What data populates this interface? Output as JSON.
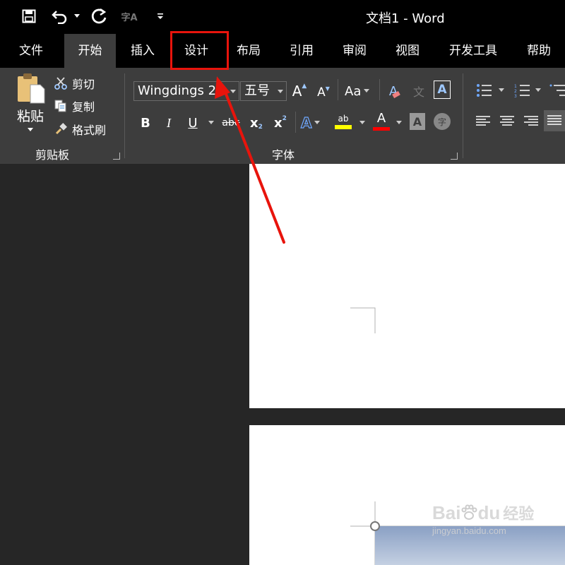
{
  "titlebar": {
    "title": "文档1  -  Word",
    "qat_icons": [
      "save-icon",
      "undo-icon",
      "redo-icon",
      "spelling-icon",
      "customize-qat-icon"
    ],
    "spelling_label": "字A"
  },
  "tabs": [
    {
      "label": "文件",
      "active": false
    },
    {
      "label": "开始",
      "active": true
    },
    {
      "label": "插入",
      "active": false
    },
    {
      "label": "设计",
      "active": false
    },
    {
      "label": "布局",
      "active": false
    },
    {
      "label": "引用",
      "active": false
    },
    {
      "label": "审阅",
      "active": false
    },
    {
      "label": "视图",
      "active": false
    },
    {
      "label": "开发工具",
      "active": false
    },
    {
      "label": "帮助",
      "active": false
    }
  ],
  "clipboard": {
    "paste": "粘贴",
    "cut": "剪切",
    "copy": "复制",
    "format_painter": "格式刷",
    "group_label": "剪贴板"
  },
  "font": {
    "name": "Wingdings 2",
    "size": "五号",
    "grow": "A",
    "shrink": "A",
    "change_case": "Aa",
    "clear_format": "A",
    "phonetic": "文",
    "char_border": "A",
    "bold": "B",
    "italic": "I",
    "underline": "U",
    "strikethrough": "abc",
    "subscript": "x",
    "subscript_mark": "2",
    "superscript": "x",
    "superscript_mark": "2",
    "text_effects": "A",
    "highlight": "ab",
    "font_color": "A",
    "char_shading": "A",
    "enclose_char": "字",
    "group_label": "字体"
  },
  "colors": {
    "highlight_box": "#e8140c",
    "highlight_color": "#ffff00",
    "font_color": "#ff0000",
    "active_tab": "#3d3d3d"
  },
  "watermark": {
    "brand": "Bai",
    "brand2": "du",
    "brand_cn": "经验",
    "url": "jingyan.baidu.com"
  }
}
